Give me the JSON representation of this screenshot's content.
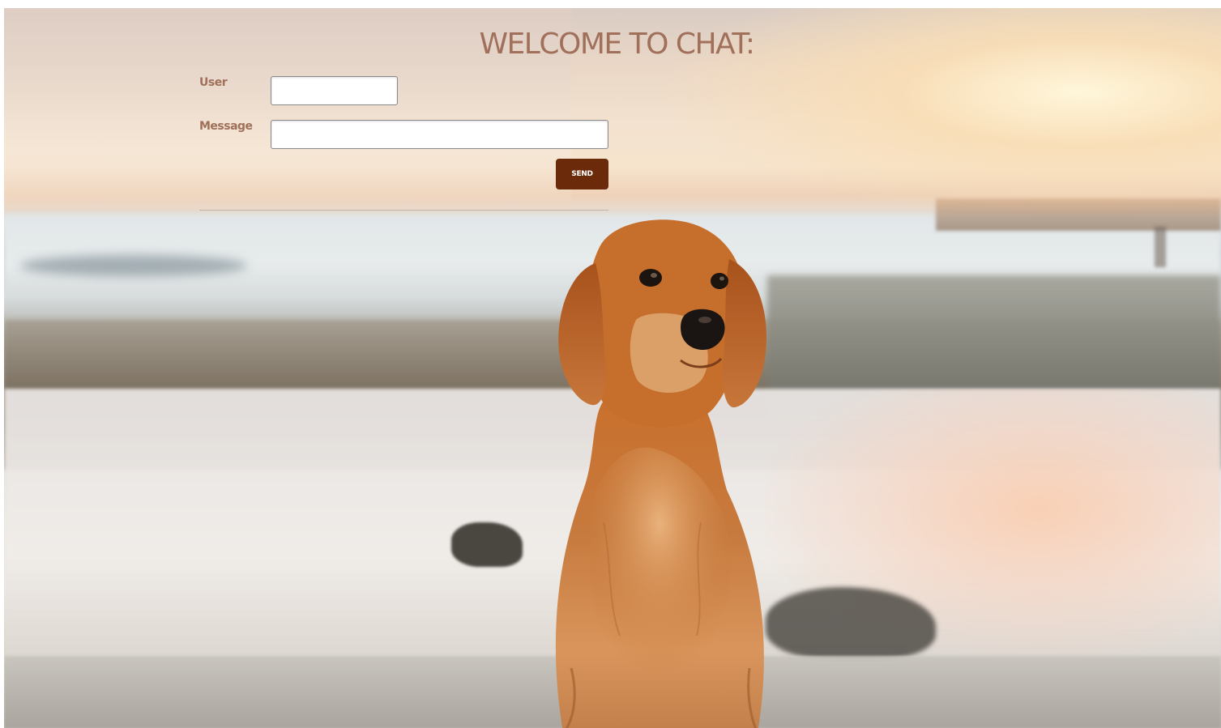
{
  "page": {
    "title": "WELCOME TO CHAT:"
  },
  "form": {
    "user_label": "User",
    "user_value": "",
    "message_label": "Message",
    "message_value": "",
    "send_label": "SEND"
  },
  "colors": {
    "title_text": "#a0705a",
    "label_text": "#a0705a",
    "send_button_bg": "#6b2a0a",
    "send_button_text": "#ffffff"
  },
  "background": {
    "image_subject": "golden-retriever-on-beach-at-sunset"
  }
}
